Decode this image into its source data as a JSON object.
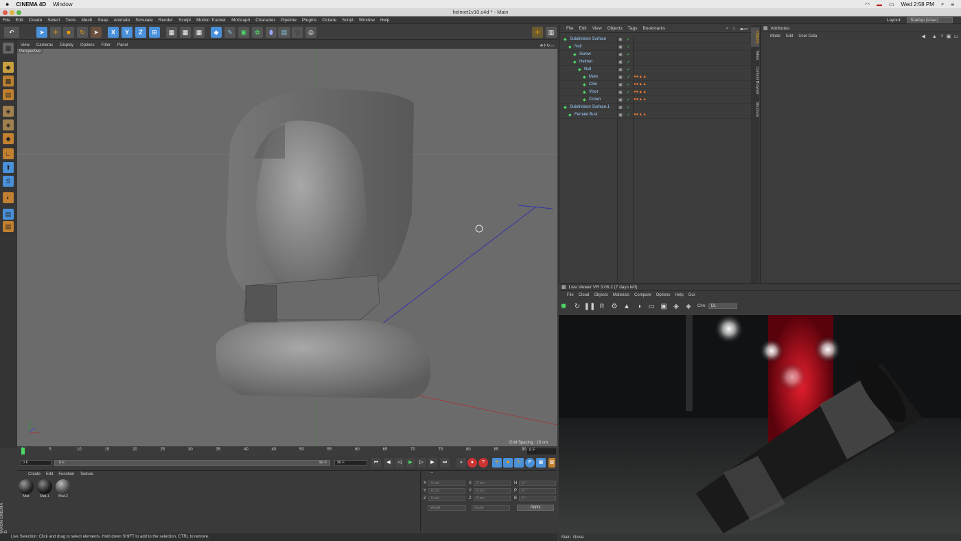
{
  "mac": {
    "apple": "",
    "app": "CINEMA 4D",
    "menu": "Window",
    "clock": "Wed 2:58 PM"
  },
  "window": {
    "title": "helmet1v10.c4d * - Main"
  },
  "menu": [
    "File",
    "Edit",
    "Create",
    "Select",
    "Tools",
    "Mesh",
    "Snap",
    "Animate",
    "Simulate",
    "Render",
    "Sculpt",
    "Motion Tracker",
    "MoGraph",
    "Character",
    "Pipeline",
    "Plugins",
    "Octane",
    "Script",
    "Window",
    "Help"
  ],
  "layout": {
    "label": "Layout:",
    "value": "Startup (User)"
  },
  "viewport": {
    "menu": [
      "View",
      "Cameras",
      "Display",
      "Options",
      "Filter",
      "Panel"
    ],
    "name": "Perspective",
    "grid": "Grid Spacing : 10 cm"
  },
  "timeline": {
    "ticks": [
      "0",
      "5",
      "10",
      "15",
      "20",
      "25",
      "30",
      "35",
      "40",
      "45",
      "50",
      "55",
      "60",
      "65",
      "70",
      "75",
      "80",
      "85",
      "90"
    ],
    "current": "0 F",
    "end": "90 F"
  },
  "transport": {
    "start": "0 F",
    "scrub_start": "0 F",
    "scrub_end": "90 F",
    "end": "90 F"
  },
  "materials": {
    "menu": [
      "Create",
      "Edit",
      "Function",
      "Texture"
    ],
    "items": [
      "Mat",
      "Mat.1",
      "Mat.2"
    ]
  },
  "coords": {
    "head": "--",
    "rows": [
      {
        "a": "X",
        "av": "0 cm",
        "b": "X",
        "bv": "0 cm",
        "c": "H",
        "cv": "0 °"
      },
      {
        "a": "Y",
        "av": "0 cm",
        "b": "Y",
        "bv": "0 cm",
        "c": "P",
        "cv": "0 °"
      },
      {
        "a": "Z",
        "av": "0 cm",
        "b": "Z",
        "bv": "0 cm",
        "c": "B",
        "cv": "0 °"
      }
    ],
    "world": "World",
    "scale": "Scale",
    "apply": "Apply"
  },
  "status": "Live Selection: Click and drag to select elements. Hold down SHIFT to add to the selection, CTRL to remove.",
  "objects": {
    "menu": [
      "File",
      "Edit",
      "View",
      "Objects",
      "Tags",
      "Bookmarks"
    ],
    "rows": [
      {
        "name": "Subdivision Surface",
        "indent": 0
      },
      {
        "name": "Null",
        "indent": 1
      },
      {
        "name": "Screw",
        "indent": 2
      },
      {
        "name": "Helmet",
        "indent": 2
      },
      {
        "name": "Null",
        "indent": 3
      },
      {
        "name": "Main",
        "indent": 4
      },
      {
        "name": "Chin",
        "indent": 4
      },
      {
        "name": "Visor",
        "indent": 4
      },
      {
        "name": "Crown",
        "indent": 4
      },
      {
        "name": "Subdivision Surface.1",
        "indent": 0
      },
      {
        "name": "Female Bust",
        "indent": 1
      }
    ]
  },
  "sidetabs": [
    "Objects",
    "Takes",
    "Content Browser",
    "Structure"
  ],
  "attributes": {
    "title": "Attributes",
    "menu": [
      "Mode",
      "Edit",
      "User Data"
    ]
  },
  "liveviewer": {
    "title": "Live Viewer VR 3.06.2 (7 days left)",
    "menu": [
      "File",
      "Cloud",
      "Objects",
      "Materials",
      "Compare",
      "Options",
      "Help",
      "Gui"
    ],
    "chn_label": "Chn:",
    "chn_value": "DL",
    "tabs": [
      "Main",
      "Noise"
    ]
  },
  "colors": {
    "accent": "#f0a000",
    "select": "#4a90d9",
    "bg": "#3a3a3a"
  },
  "brand": "MAXON CINEMA 4D"
}
